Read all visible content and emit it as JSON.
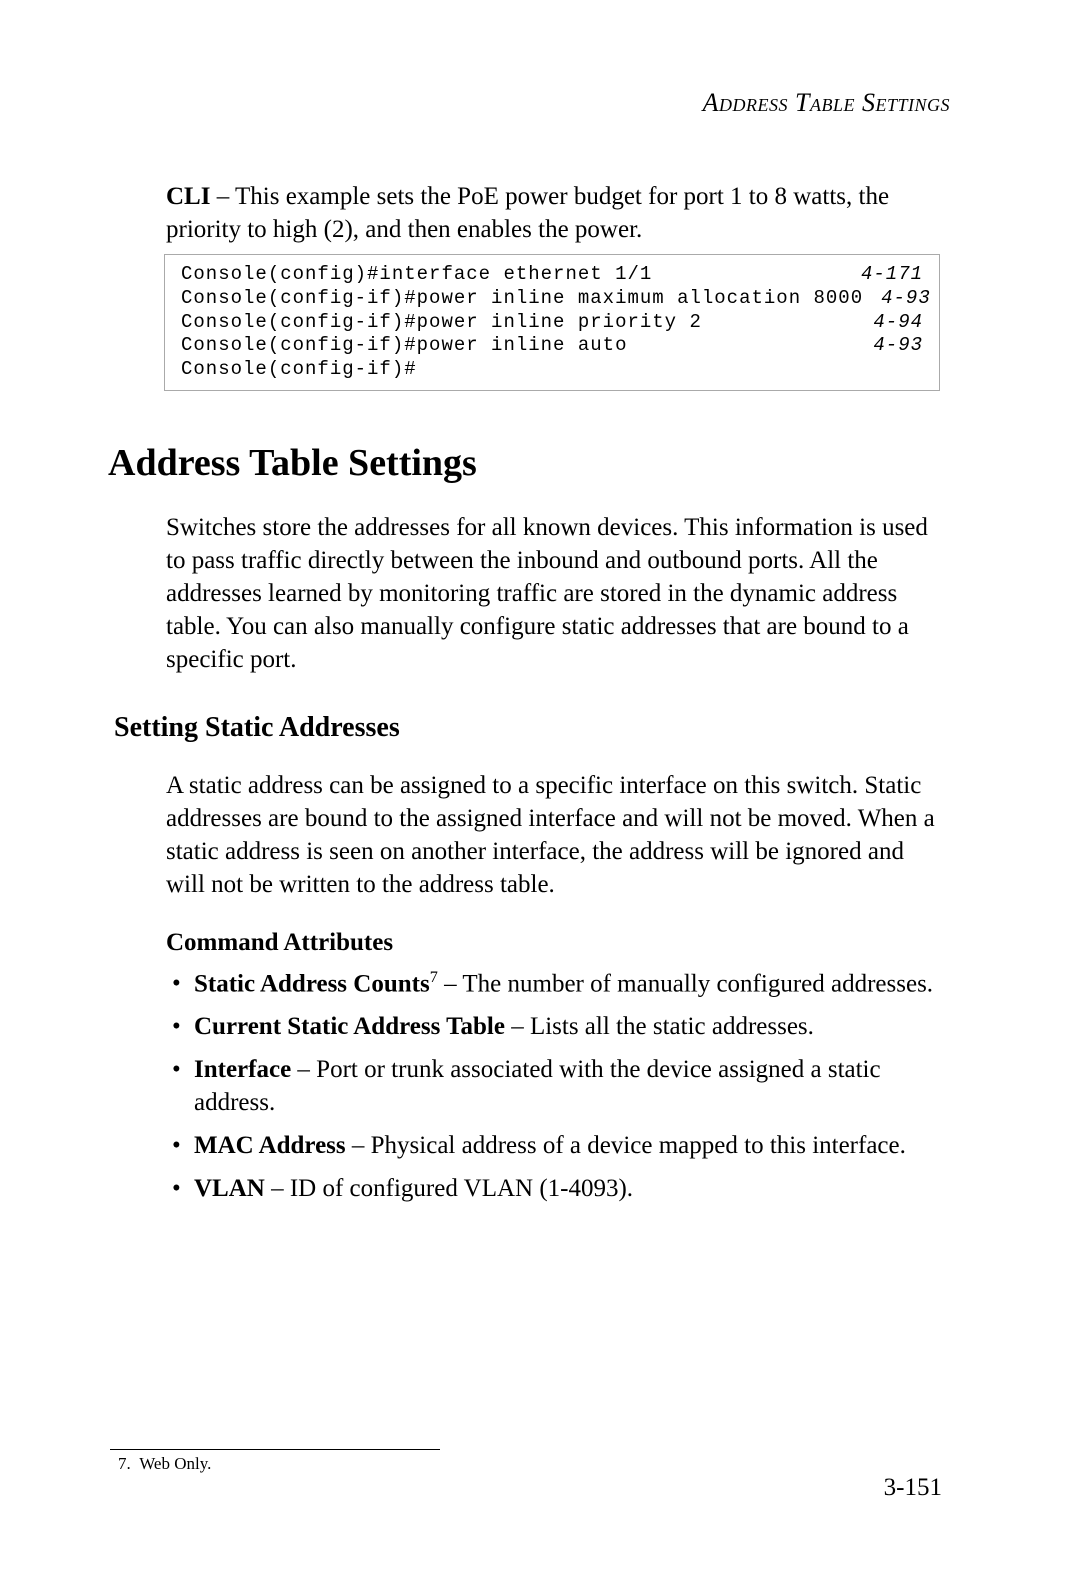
{
  "header": {
    "running": "Address Table Settings"
  },
  "intro": {
    "lead": "CLI",
    "text": " – This example sets the PoE power budget for port 1 to 8 watts, the priority to high (2), and then enables the power."
  },
  "code": {
    "lines": [
      {
        "cmd": "Console(config)#interface ethernet 1/1",
        "ref": "4-171"
      },
      {
        "cmd": "Console(config-if)#power inline maximum allocation 8000",
        "ref": "4-93"
      },
      {
        "cmd": "Console(config-if)#power inline priority 2",
        "ref": "4-94"
      },
      {
        "cmd": "Console(config-if)#power inline auto",
        "ref": "4-93"
      },
      {
        "cmd": "Console(config-if)#",
        "ref": ""
      }
    ]
  },
  "section": {
    "title": "Address Table Settings",
    "para": "Switches store the addresses for all known devices. This information is used to pass traffic directly between the inbound and outbound ports. All the addresses learned by monitoring traffic are stored in the dynamic address table. You can also manually configure static addresses that are bound to a specific port."
  },
  "subsection": {
    "title": "Setting Static Addresses",
    "para": "A static address can be assigned to a specific interface on this switch. Static addresses are bound to the assigned interface and will not be moved. When a static address is seen on another interface, the address will be ignored and will not be written to the address table."
  },
  "attrs": {
    "heading": "Command Attributes",
    "items": [
      {
        "term": "Static Address Counts",
        "sup": "7",
        "desc": " – The number of manually configured addresses."
      },
      {
        "term": "Current Static Address Table",
        "sup": "",
        "desc": " – Lists all the static addresses."
      },
      {
        "term": "Interface",
        "sup": "",
        "desc": " – Port or trunk associated with the device assigned a static address."
      },
      {
        "term": "MAC Address",
        "sup": "",
        "desc": " – Physical address of a device mapped to this interface."
      },
      {
        "term": "VLAN",
        "sup": "",
        "desc": " – ID of configured VLAN (1-4093)."
      }
    ]
  },
  "footnote": {
    "marker": "7.",
    "text": "Web Only."
  },
  "page": {
    "number": "3-151"
  }
}
